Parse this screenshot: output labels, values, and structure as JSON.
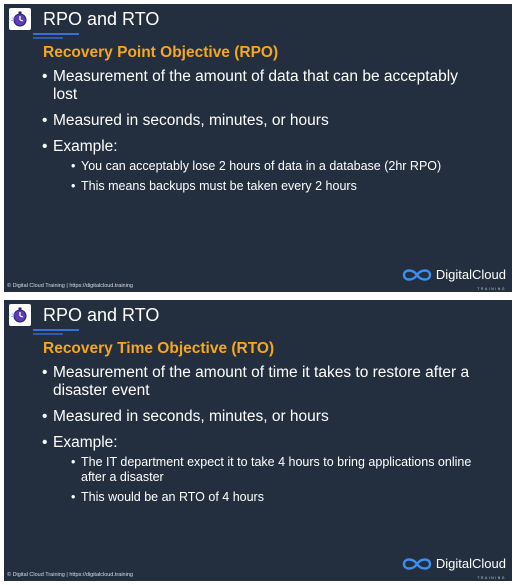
{
  "slides": [
    {
      "title": "RPO and RTO",
      "heading": "Recovery Point Objective (RPO)",
      "bullets": [
        "Measurement of the amount of data that can be acceptably lost",
        "Measured in seconds, minutes, or hours",
        "Example:"
      ],
      "sub_bullets": [
        "You can acceptably lose 2 hours of data in a database (2hr RPO)",
        "This means backups must be taken every 2 hours"
      ],
      "footer": "© Digital Cloud Training  |  https://digitalcloud.training",
      "brand_name": "DigitalCloud",
      "brand_sub": "TRAINING"
    },
    {
      "title": "RPO and RTO",
      "heading": "Recovery Time Objective (RTO)",
      "bullets": [
        "Measurement of the amount of time it takes to restore after a disaster event",
        "Measured in seconds, minutes, or hours",
        "Example:"
      ],
      "sub_bullets": [
        "The IT department expect it to take 4 hours to bring applications online after a disaster",
        "This would be an RTO of 4 hours"
      ],
      "footer": "© Digital Cloud Training  |  https://digitalcloud.training",
      "brand_name": "DigitalCloud",
      "brand_sub": "TRAINING"
    }
  ],
  "icons": {
    "slide_logo": "stopwatch-icon",
    "brand_logo": "cloud-infinity-logo"
  },
  "colors": {
    "slide_background": "#232f3e",
    "heading": "#f5a623",
    "text": "#ffffff",
    "accent": "#3b6fd6"
  }
}
